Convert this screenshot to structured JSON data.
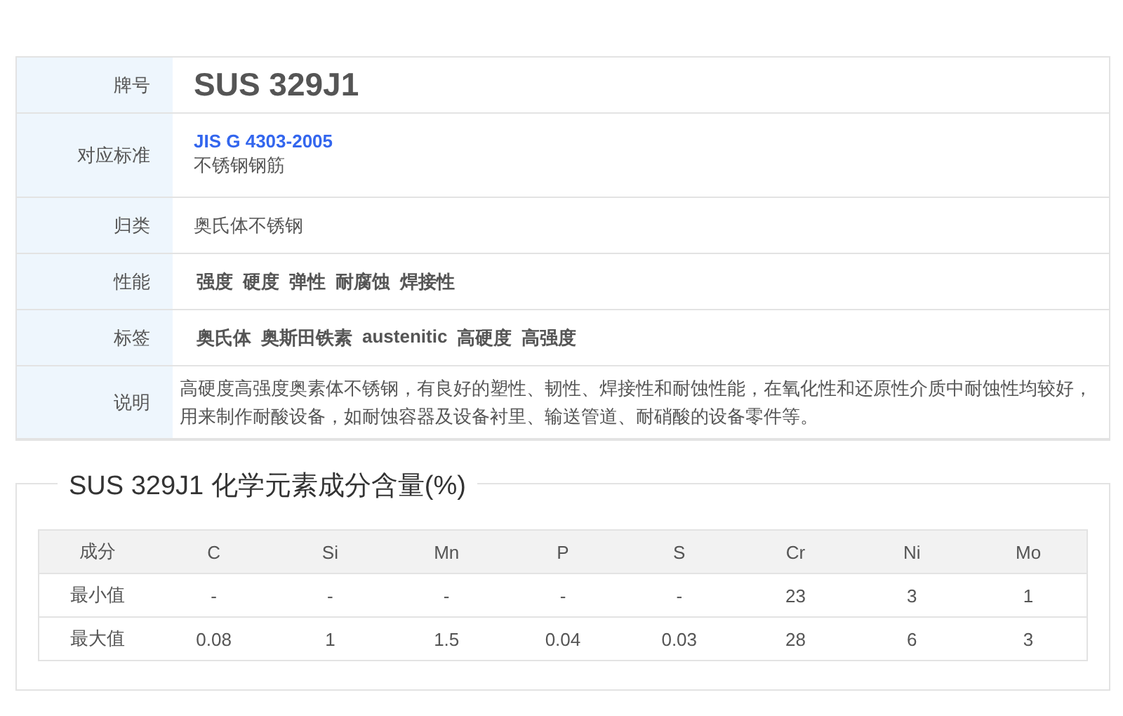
{
  "info_rows": [
    {
      "kind": "title",
      "label": "牌号",
      "value": "SUS 329J1"
    },
    {
      "kind": "standard",
      "label": "对应标准",
      "link": "JIS G 4303-2005",
      "value": "不锈钢钢筋"
    },
    {
      "kind": "text",
      "label": "归类",
      "value": "奥氏体不锈钢"
    },
    {
      "kind": "tags",
      "label": "性能",
      "tags": [
        "强度",
        "硬度",
        "弹性",
        "耐腐蚀",
        "焊接性"
      ]
    },
    {
      "kind": "tags",
      "label": "标签",
      "tags": [
        "奥氏体",
        "奥斯田铁素",
        "austenitic",
        "高硬度",
        "高强度"
      ]
    },
    {
      "kind": "paragraph",
      "label": "说明",
      "value": "高硬度高强度奥素体不锈钢，有良好的塑性、韧性、焊接性和耐蚀性能，在氧化性和还原性介质中耐蚀性均较好，用来制作耐酸设备，如耐蚀容器及设备衬里、输送管道、耐硝酸的设备零件等。"
    }
  ],
  "composition": {
    "title": "SUS 329J1 化学元素成分含量(%)",
    "columns": [
      "成分",
      "C",
      "Si",
      "Mn",
      "P",
      "S",
      "Cr",
      "Ni",
      "Mo"
    ],
    "rows": [
      [
        "最小值",
        "-",
        "-",
        "-",
        "-",
        "-",
        "23",
        "3",
        "1"
      ],
      [
        "最大值",
        "0.08",
        "1",
        "1.5",
        "0.04",
        "0.03",
        "28",
        "6",
        "3"
      ]
    ]
  }
}
